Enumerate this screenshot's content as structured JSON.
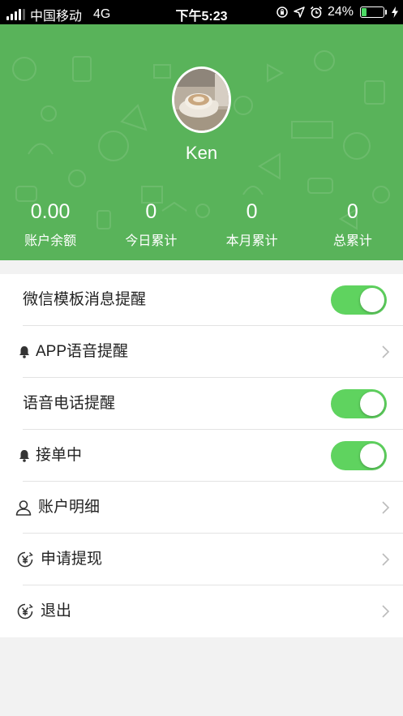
{
  "status_bar": {
    "carrier": "中国移动",
    "network": "4G",
    "time": "下午5:23",
    "battery_percent": "24%",
    "battery_level": 0.24,
    "icons": [
      "orientation-lock-icon",
      "location-icon",
      "alarm-icon",
      "battery-icon",
      "charging-icon"
    ]
  },
  "profile": {
    "username": "Ken"
  },
  "stats": [
    {
      "value": "0.00",
      "label": "账户余额"
    },
    {
      "value": "0",
      "label": "今日累计"
    },
    {
      "value": "0",
      "label": "本月累计"
    },
    {
      "value": "0",
      "label": "总累计"
    }
  ],
  "menu": {
    "wechat_template": {
      "label": "微信模板消息提醒",
      "on": true
    },
    "app_voice": {
      "label": "APP语音提醒",
      "icon": "bell-icon"
    },
    "voice_call": {
      "label": "语音电话提醒",
      "on": true
    },
    "accepting_orders": {
      "label": "接单中",
      "icon": "bell-icon",
      "on": true
    },
    "account_details": {
      "label": "账户明细",
      "icon": "user-icon"
    },
    "withdraw": {
      "label": "申请提现",
      "icon": "yen-circle-icon"
    },
    "logout": {
      "label": "退出",
      "icon": "yen-circle-icon"
    }
  },
  "colors": {
    "header_green": "#59b35a",
    "toggle_green": "#5fd35f"
  }
}
